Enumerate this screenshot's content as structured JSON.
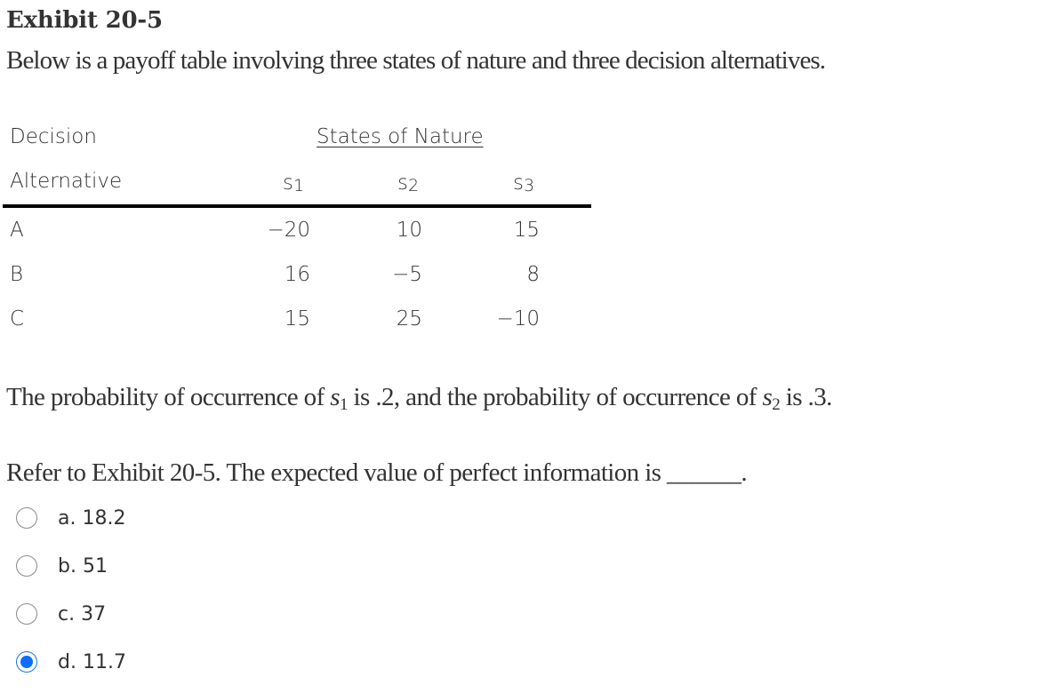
{
  "exhibit": {
    "title": "Exhibit 20-5",
    "description": "Below is a payoff table involving three states of nature and three decision alternatives."
  },
  "payoff_table": {
    "header_col1_line1": "Decision",
    "header_col1_line2": "Alternative",
    "group_header": "States of Nature",
    "states": [
      {
        "letter": "s",
        "sub": "1"
      },
      {
        "letter": "s",
        "sub": "2"
      },
      {
        "letter": "s",
        "sub": "3"
      }
    ],
    "rows": [
      {
        "alternative": "A",
        "values": [
          "−20",
          "10",
          "15"
        ]
      },
      {
        "alternative": "B",
        "values": [
          "16",
          "−5",
          "8"
        ]
      },
      {
        "alternative": "C",
        "values": [
          "15",
          "25",
          "−10"
        ]
      }
    ]
  },
  "probability": {
    "part1": "The probability of occurrence of ",
    "s1_letter": "s",
    "s1_sub": "1",
    "part2": " is .2, and the probability of occurrence of ",
    "s2_letter": "s",
    "s2_sub": "2",
    "part3": " is .3."
  },
  "question": {
    "text": "Refer to Exhibit 20-5. The expected value of perfect information is ______."
  },
  "options": [
    {
      "label": "a. 18.2",
      "selected": false
    },
    {
      "label": "b. 51",
      "selected": false
    },
    {
      "label": "c. 37",
      "selected": false
    },
    {
      "label": "d. 11.7",
      "selected": true
    }
  ],
  "colors": {
    "text": "#333333",
    "radio_selected": "#0d6efd",
    "radio_border": "#8a8a8a",
    "table_rule": "#000000"
  }
}
